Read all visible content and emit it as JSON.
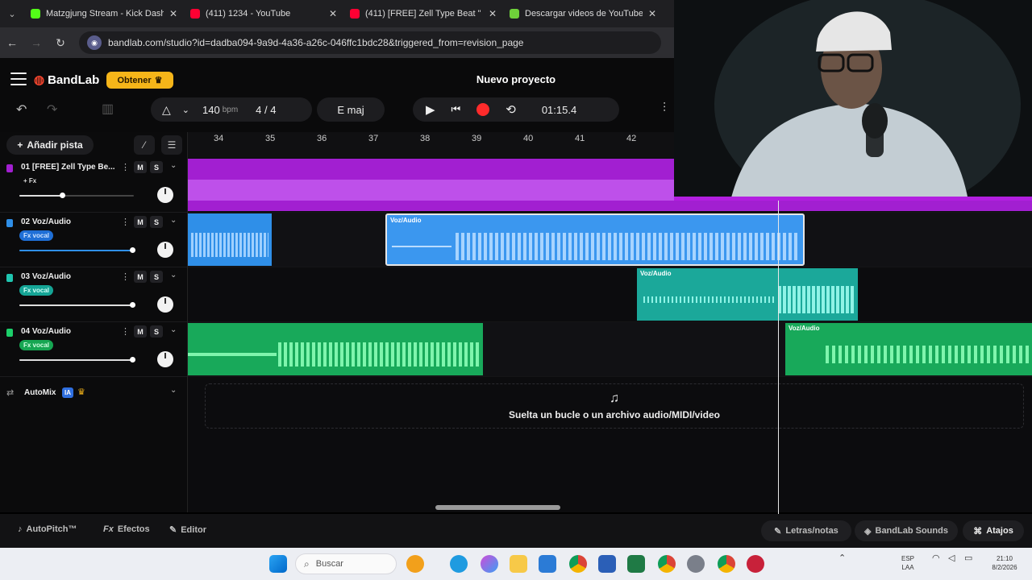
{
  "browser": {
    "tabs": [
      {
        "title": "Matzgjung Stream - Kick Dash",
        "color": "#53fc18"
      },
      {
        "title": "(411) 1234 - YouTube",
        "color": "#ff0033"
      },
      {
        "title": "(411) [FREE] Zell Type Beat \" E",
        "color": "#ff0033"
      },
      {
        "title": "Descargar videos de YouTube",
        "color": "#6fd13a"
      }
    ],
    "url": "bandlab.com/studio?id=dadba094-9a9d-4a36-a26c-046ffc1bdc28&triggered_from=revision_page"
  },
  "header": {
    "brand": "BandLab",
    "obtener": "Obtener",
    "project_title": "Nuevo proyecto",
    "tempo": "140",
    "tempo_unit": "bpm",
    "time_signature": "4 / 4",
    "key": "E maj",
    "time": "01:15.4"
  },
  "sidebar": {
    "add_track": "Añadir pista",
    "automix": "AutoMix",
    "automix_badge": "IA"
  },
  "ruler": {
    "bars": [
      "34",
      "35",
      "36",
      "37",
      "38",
      "39",
      "40",
      "41",
      "42"
    ]
  },
  "tracks": [
    {
      "name": "01  [FREE] Zell Type Be...",
      "fx": "+ Fx",
      "color": "#a21fd1",
      "volume": 0.38,
      "mute": "M",
      "solo": "S"
    },
    {
      "name": "02  Voz/Audio",
      "fx": "Fx vocal",
      "color": "#2f8fe8",
      "volume": 1.0,
      "mute": "M",
      "solo": "S"
    },
    {
      "name": "03  Voz/Audio",
      "fx": "Fx vocal",
      "color": "#1fc6b0",
      "volume": 1.0,
      "mute": "M",
      "solo": "S"
    },
    {
      "name": "04  Voz/Audio",
      "fx": "Fx vocal",
      "color": "#1ccf6a",
      "volume": 1.0,
      "mute": "M",
      "solo": "S"
    }
  ],
  "clips": {
    "label": "Voz/Audio"
  },
  "drop_zone": {
    "text": "Suelta un bucle o un archivo audio/MIDI/video"
  },
  "bottom": {
    "autopitch": "AutoPitch™",
    "efectos": "Efectos",
    "editor": "Editor",
    "letras": "Letras/notas",
    "sounds": "BandLab Sounds",
    "atajos": "Atajos"
  },
  "taskbar": {
    "search": "Buscar",
    "lang_top": "ESP",
    "lang_bottom": "LAA",
    "clock": "21:10",
    "date": "8/2/2026"
  }
}
